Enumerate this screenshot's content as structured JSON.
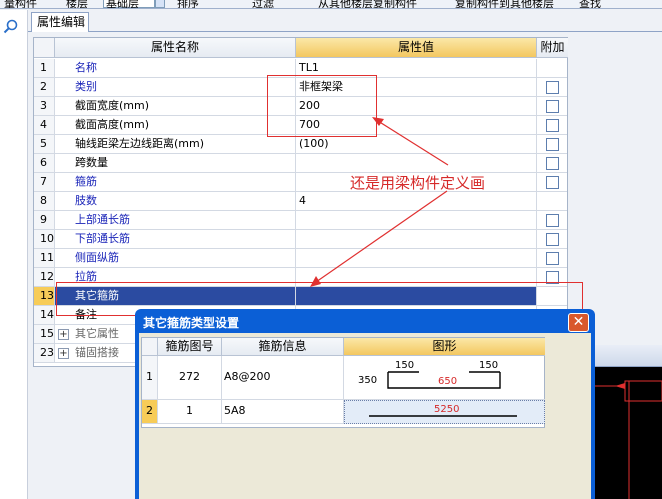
{
  "toolbar": {
    "items": [
      "量构件",
      "楼层",
      "基础层",
      "排序",
      "过滤",
      "从其他楼层复制构件",
      "复制构件到其他楼层",
      "查找"
    ]
  },
  "tab": {
    "label": "属性编辑"
  },
  "grid": {
    "headers": {
      "name": "属性名称",
      "value": "属性值",
      "add": "附加"
    },
    "rows": [
      {
        "num": "1",
        "name": "名称",
        "value": "TL1",
        "color": "blue",
        "check": false
      },
      {
        "num": "2",
        "name": "类别",
        "value": "非框架梁",
        "color": "blue",
        "check": true
      },
      {
        "num": "3",
        "name": "截面宽度(mm)",
        "value": "200",
        "color": "black",
        "check": true
      },
      {
        "num": "4",
        "name": "截面高度(mm)",
        "value": "700",
        "color": "black",
        "check": true
      },
      {
        "num": "5",
        "name": "轴线距梁左边线距离(mm)",
        "value": "(100)",
        "color": "black",
        "check": true
      },
      {
        "num": "6",
        "name": "跨数量",
        "value": "",
        "color": "black",
        "check": true
      },
      {
        "num": "7",
        "name": "箍筋",
        "value": "",
        "color": "blue",
        "check": true
      },
      {
        "num": "8",
        "name": "肢数",
        "value": "4",
        "color": "blue",
        "check": false
      },
      {
        "num": "9",
        "name": "上部通长筋",
        "value": "",
        "color": "blue",
        "check": true
      },
      {
        "num": "10",
        "name": "下部通长筋",
        "value": "",
        "color": "blue",
        "check": true
      },
      {
        "num": "11",
        "name": "侧面纵筋",
        "value": "",
        "color": "blue",
        "check": true
      },
      {
        "num": "12",
        "name": "拉筋",
        "value": "",
        "color": "blue",
        "check": true
      },
      {
        "num": "13",
        "name": "其它箍筋",
        "value": "",
        "color": "selected",
        "check": false
      },
      {
        "num": "14",
        "name": "备注",
        "value": "",
        "color": "black",
        "check": false
      },
      {
        "num": "15",
        "name": "其它属性",
        "value": "",
        "color": "gray",
        "check": false,
        "group": true
      },
      {
        "num": "23",
        "name": "锚固搭接",
        "value": "",
        "color": "gray",
        "check": false,
        "group": true
      }
    ]
  },
  "annotation": {
    "text": "还是用梁构件定义画"
  },
  "dialog": {
    "title": "其它箍筋类型设置",
    "close_label": "✕",
    "headers": {
      "tu": "箍筋图号",
      "info": "箍筋信息",
      "shape": "图形"
    },
    "rows": [
      {
        "num": "1",
        "tu": "272",
        "info": "A8@200",
        "left": "350",
        "top_left": "150",
        "top_right": "150",
        "middle": "650"
      },
      {
        "num": "2",
        "tu": "1",
        "info": "5A8",
        "length": "5250"
      }
    ]
  },
  "colors": {
    "accent": "#0b5fd6",
    "header_gold": "#f3c760",
    "selection": "#2b4ba1",
    "annotation_red": "#e03030",
    "label_blue": "#1a24b8"
  }
}
